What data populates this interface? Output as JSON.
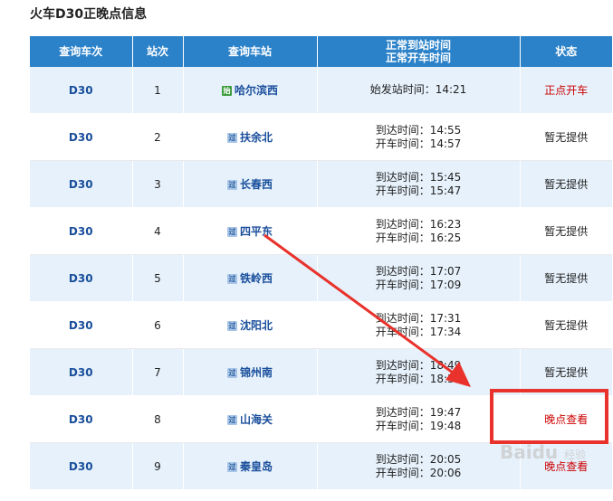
{
  "page": {
    "title": "火车D30正晚点信息"
  },
  "table": {
    "headers": {
      "train": "查询车次",
      "order": "站次",
      "station": "查询车站",
      "time_line1": "正常到站时间",
      "time_line2": "正常开车时间",
      "status": "状态"
    },
    "rows": [
      {
        "train": "D30",
        "order": "1",
        "icon": "始",
        "icon_type": "start",
        "station": "哈尔滨西",
        "single": "始发站时间：14:21",
        "status": "正点开车",
        "status_color": "red"
      },
      {
        "train": "D30",
        "order": "2",
        "icon": "过",
        "icon_type": "pass",
        "station": "扶余北",
        "arrive": "到达时间：14:55",
        "depart": "开车时间：14:57",
        "status": "暂无提供",
        "status_color": "plain"
      },
      {
        "train": "D30",
        "order": "3",
        "icon": "过",
        "icon_type": "pass",
        "station": "长春西",
        "arrive": "到达时间：15:45",
        "depart": "开车时间：15:47",
        "status": "暂无提供",
        "status_color": "plain"
      },
      {
        "train": "D30",
        "order": "4",
        "icon": "过",
        "icon_type": "pass",
        "station": "四平东",
        "arrive": "到达时间：16:23",
        "depart": "开车时间：16:25",
        "status": "暂无提供",
        "status_color": "plain"
      },
      {
        "train": "D30",
        "order": "5",
        "icon": "过",
        "icon_type": "pass",
        "station": "铁岭西",
        "arrive": "到达时间：17:07",
        "depart": "开车时间：17:09",
        "status": "暂无提供",
        "status_color": "plain"
      },
      {
        "train": "D30",
        "order": "6",
        "icon": "过",
        "icon_type": "pass",
        "station": "沈阳北",
        "arrive": "到达时间：17:31",
        "depart": "开车时间：17:34",
        "status": "暂无提供",
        "status_color": "plain"
      },
      {
        "train": "D30",
        "order": "7",
        "icon": "过",
        "icon_type": "pass",
        "station": "锦州南",
        "arrive": "到达时间：18:49",
        "depart": "开车时间：18:51",
        "status": "暂无提供",
        "status_color": "plain"
      },
      {
        "train": "D30",
        "order": "8",
        "icon": "过",
        "icon_type": "pass",
        "station": "山海关",
        "arrive": "到达时间：19:47",
        "depart": "开车时间：19:48",
        "status": "晚点查看",
        "status_color": "red"
      },
      {
        "train": "D30",
        "order": "9",
        "icon": "过",
        "icon_type": "pass",
        "station": "秦皇岛",
        "arrive": "到达时间：20:05",
        "depart": "开车时间：20:06",
        "status": "晚点查看",
        "status_color": "red"
      }
    ]
  },
  "annotation": {
    "color": "#e8322b"
  },
  "watermark": {
    "text": "Baidu",
    "sub": "经验"
  }
}
